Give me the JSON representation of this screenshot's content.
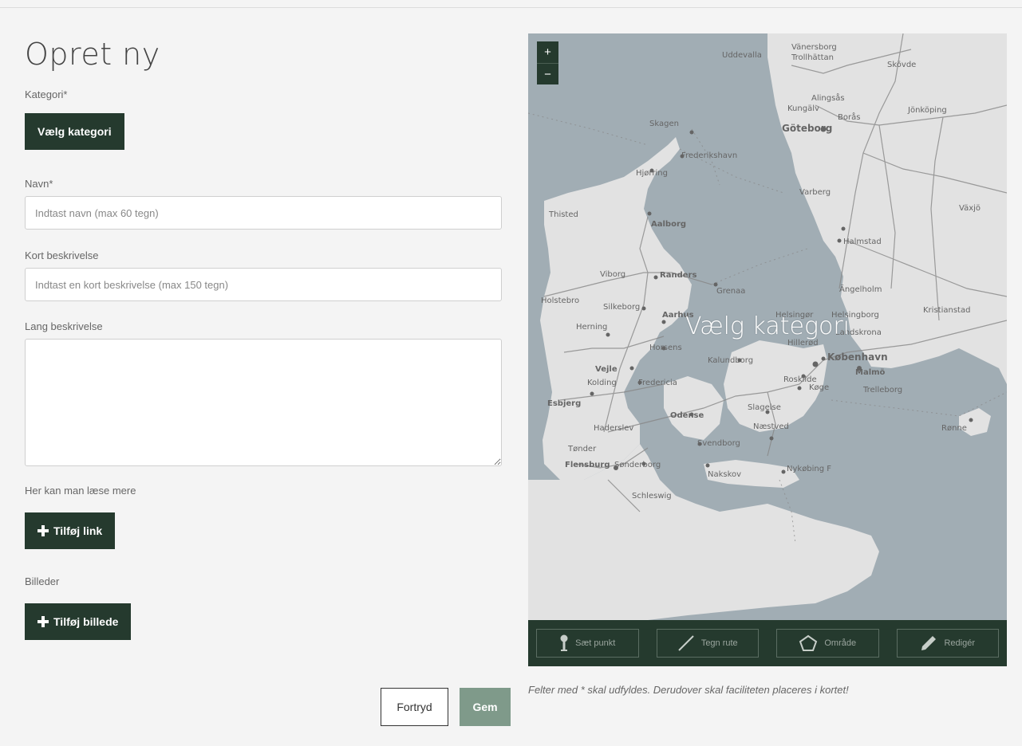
{
  "page": {
    "title": "Opret ny"
  },
  "category": {
    "label": "Kategori*",
    "button_label": "Vælg kategori"
  },
  "name": {
    "label": "Navn*",
    "placeholder": "Indtast navn (max 60 tegn)"
  },
  "short_description": {
    "label": "Kort beskrivelse",
    "placeholder": "Indtast en kort beskrivelse (max 150 tegn)"
  },
  "long_description": {
    "label": "Lang beskrivelse"
  },
  "links": {
    "label": "Her kan man læse mere",
    "button_label": "Tilføj link"
  },
  "images": {
    "label": "Billeder",
    "button_label": "Tilføj billede"
  },
  "actions": {
    "cancel_label": "Fortryd",
    "save_label": "Gem"
  },
  "map": {
    "overlay_text": "Vælg kategori",
    "zoom_in": "+",
    "zoom_out": "−",
    "place_labels": [
      "Uddevalla",
      "Vänersborg",
      "Trollhättan",
      "Skövde",
      "Alingsås",
      "Kungälv",
      "Borås",
      "Jönköping",
      "Göteborg",
      "Skagen",
      "Frederikshavn",
      "Hjørring",
      "Varberg",
      "Thisted",
      "Aalborg",
      "Växjö",
      "Halmstad",
      "Viborg",
      "Randers",
      "Grenaa",
      "Ängelholm",
      "Holstebro",
      "Silkeborg",
      "Helsingør",
      "Helsingborg",
      "Kristianstad",
      "Aarhus",
      "Herning",
      "Hillerød",
      "Landskrona",
      "Horsens",
      "Kalundborg",
      "København",
      "Vejle",
      "Malmö",
      "Kolding",
      "Fredericia",
      "Roskilde",
      "Køge",
      "Trelleborg",
      "Esbjerg",
      "Odense",
      "Slagelse",
      "Haderslev",
      "Næstved",
      "Rønne",
      "Svendborg",
      "Tønder",
      "Sønderborg",
      "Flensburg",
      "Nakskov",
      "Nykøbing F",
      "Schleswig"
    ],
    "tools": [
      {
        "label": "Sæt punkt",
        "icon": "pin-icon"
      },
      {
        "label": "Tegn rute",
        "icon": "line-icon"
      },
      {
        "label": "Område",
        "icon": "pentagon-icon"
      },
      {
        "label": "Redigér",
        "icon": "pencil-icon"
      }
    ]
  },
  "note": "Felter med * skal udfyldes. Derudover skal faciliteten placeres i kortet!"
}
